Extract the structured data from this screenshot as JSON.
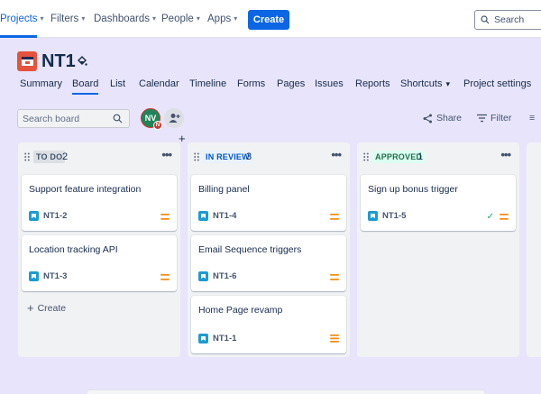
{
  "topnav": {
    "items": [
      {
        "label": "Projects",
        "active": true
      },
      {
        "label": "Filters"
      },
      {
        "label": "Dashboards"
      },
      {
        "label": "People"
      },
      {
        "label": "Apps"
      }
    ],
    "create_label": "Create",
    "search_placeholder": "Search"
  },
  "project": {
    "title": "NT1",
    "tabs": [
      "Summary",
      "Board",
      "List",
      "Calendar",
      "Timeline",
      "Forms",
      "Pages",
      "Issues",
      "Reports",
      "Shortcuts",
      "Project settings"
    ],
    "active_tab": "Board"
  },
  "toolbar": {
    "search_placeholder": "Search board",
    "avatar_initials": "NV",
    "avatar_badge": "N",
    "share_label": "Share",
    "filter_label": "Filter",
    "more_label": "≡"
  },
  "columns": [
    {
      "label": "TO DO",
      "count": "2",
      "cards": [
        {
          "title": "Support feature integration",
          "key": "NT1-2"
        },
        {
          "title": "Location tracking API",
          "key": "NT1-3"
        }
      ],
      "create_label": "Create"
    },
    {
      "label": "IN REVIEW",
      "count": "3",
      "cards": [
        {
          "title": "Billing panel",
          "key": "NT1-4"
        },
        {
          "title": "Email Sequence triggers",
          "key": "NT1-6"
        },
        {
          "title": "Home Page revamp",
          "key": "NT1-1"
        }
      ]
    },
    {
      "label": "APPROVED",
      "count": "1",
      "cards": [
        {
          "title": "Sign up bonus trigger",
          "key": "NT1-5",
          "done": true
        }
      ]
    }
  ],
  "colors": {
    "accent": "#0c66e4",
    "board_bg": "#e7e4fb",
    "todo_label_bg": "#dcdfe4",
    "review_label_bg": "#e9f2ff",
    "review_label_fg": "#0055cc",
    "approved_label_bg": "#dcfff1",
    "approved_label_fg": "#216e4e",
    "priority_medium": "#f18d13"
  }
}
